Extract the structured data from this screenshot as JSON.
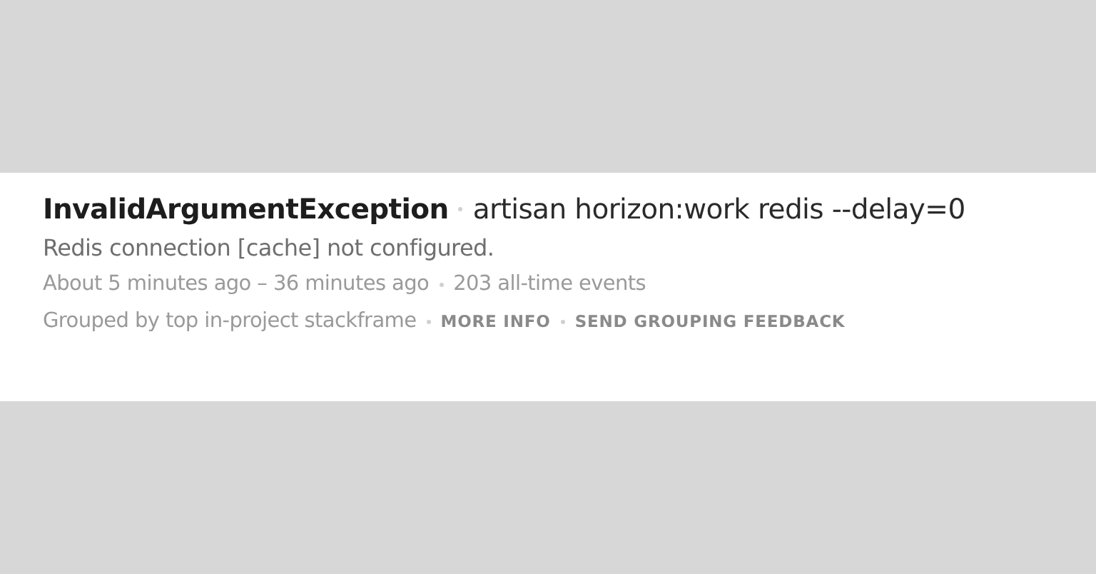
{
  "error": {
    "type": "InvalidArgumentException",
    "command": "artisan horizon:work redis --delay=0",
    "message": "Redis connection [cache] not configured.",
    "time_range": "About 5 minutes ago – 36 minutes ago",
    "events": "203 all-time events",
    "grouping": "Grouped by top in-project stackframe",
    "links": [
      "MORE INFO",
      "SEND GROUPING FEEDBACK"
    ]
  }
}
